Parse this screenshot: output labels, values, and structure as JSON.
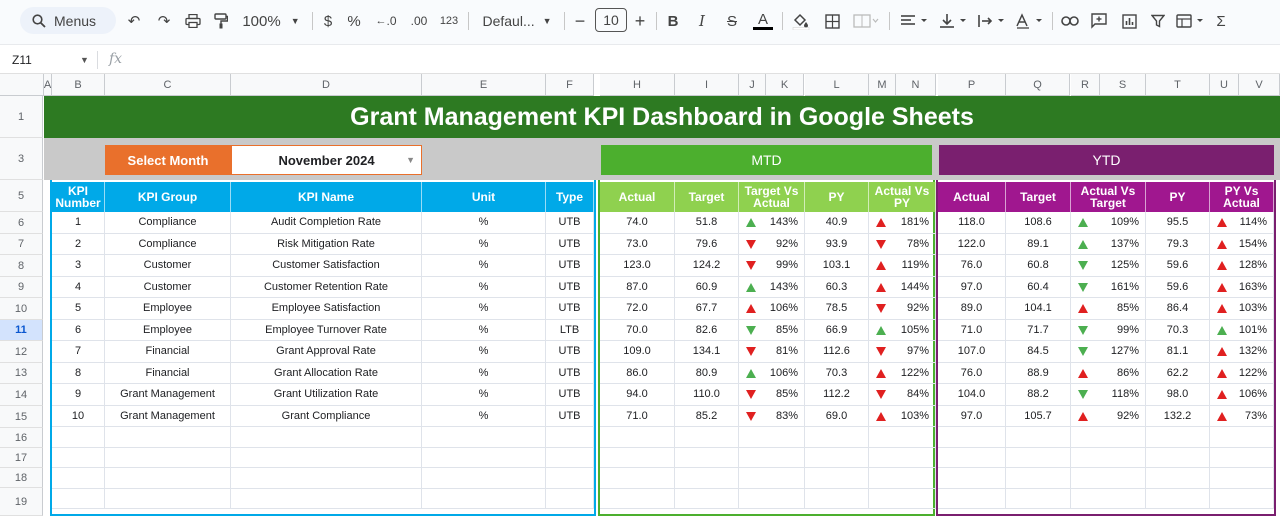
{
  "toolbar": {
    "search_label": "Menus",
    "zoom": "100%",
    "currency_symbol": "$",
    "percent_symbol": "%",
    "decimal_decrease": ".0",
    "decimal_increase": ".00",
    "number_format": "123",
    "font_name": "Defaul...",
    "font_size": "10",
    "bold": "B",
    "text_color": "A"
  },
  "formula_bar": {
    "cell_ref": "Z11",
    "fx": "fx"
  },
  "columns": [
    "A",
    "B",
    "C",
    "D",
    "E",
    "F",
    "H",
    "I",
    "J",
    "K",
    "L",
    "M",
    "N",
    "P",
    "Q",
    "R",
    "S",
    "T",
    "U",
    "V"
  ],
  "rows": [
    "1",
    "3",
    "5",
    "6",
    "7",
    "8",
    "9",
    "10",
    "11",
    "12",
    "13",
    "14",
    "15",
    "16",
    "17",
    "18",
    "19"
  ],
  "selected_row": "11",
  "dashboard": {
    "title": "Grant Management KPI Dashboard in Google Sheets",
    "select_month_label": "Select Month",
    "month_value": "November 2024",
    "mtd_label": "MTD",
    "ytd_label": "YTD"
  },
  "colors": {
    "title_bg": "#2d7a22",
    "select_month_bg": "#e9702c",
    "info_header": "#00a9e8",
    "mtd_band": "#4caf2e",
    "mtd_header": "#8fd14f",
    "ytd_band": "#7a1f6f",
    "ytd_header": "#a0178f",
    "arrow_red": "#e02020",
    "arrow_green": "#4caf50"
  },
  "info_headers": [
    "KPI Number",
    "KPI Group",
    "KPI Name",
    "Unit",
    "Type"
  ],
  "mtd_headers": [
    "Actual",
    "Target",
    "Target Vs Actual",
    "PY",
    "Actual Vs PY"
  ],
  "ytd_headers": [
    "Actual",
    "Target",
    "Actual Vs Target",
    "PY",
    "PY Vs Actual"
  ],
  "kpis": [
    {
      "num": "1",
      "group": "Compliance",
      "name": "Audit Completion Rate",
      "unit": "%",
      "type": "UTB",
      "mtd": {
        "actual": "74.0",
        "target": "51.8",
        "tva": "143%",
        "tva_icon": "up-green",
        "py": "40.9",
        "avp": "181%",
        "avp_icon": "up-red"
      },
      "ytd": {
        "actual": "118.0",
        "target": "108.6",
        "avt": "109%",
        "avt_icon": "up-green",
        "py": "95.5",
        "pva": "114%",
        "pva_icon": "up-red"
      }
    },
    {
      "num": "2",
      "group": "Compliance",
      "name": "Risk Mitigation Rate",
      "unit": "%",
      "type": "UTB",
      "mtd": {
        "actual": "73.0",
        "target": "79.6",
        "tva": "92%",
        "tva_icon": "down-red",
        "py": "93.9",
        "avp": "78%",
        "avp_icon": "down-red"
      },
      "ytd": {
        "actual": "122.0",
        "target": "89.1",
        "avt": "137%",
        "avt_icon": "up-green",
        "py": "79.3",
        "pva": "154%",
        "pva_icon": "up-red"
      }
    },
    {
      "num": "3",
      "group": "Customer",
      "name": "Customer Satisfaction",
      "unit": "%",
      "type": "UTB",
      "mtd": {
        "actual": "123.0",
        "target": "124.2",
        "tva": "99%",
        "tva_icon": "down-red",
        "py": "103.1",
        "avp": "119%",
        "avp_icon": "up-red"
      },
      "ytd": {
        "actual": "76.0",
        "target": "60.8",
        "avt": "125%",
        "avt_icon": "down-green",
        "py": "59.6",
        "pva": "128%",
        "pva_icon": "up-red"
      }
    },
    {
      "num": "4",
      "group": "Customer",
      "name": "Customer Retention Rate",
      "unit": "%",
      "type": "UTB",
      "mtd": {
        "actual": "87.0",
        "target": "60.9",
        "tva": "143%",
        "tva_icon": "up-green",
        "py": "60.3",
        "avp": "144%",
        "avp_icon": "up-red"
      },
      "ytd": {
        "actual": "97.0",
        "target": "60.4",
        "avt": "161%",
        "avt_icon": "down-green",
        "py": "59.6",
        "pva": "163%",
        "pva_icon": "up-red"
      }
    },
    {
      "num": "5",
      "group": "Employee",
      "name": "Employee Satisfaction",
      "unit": "%",
      "type": "UTB",
      "mtd": {
        "actual": "72.0",
        "target": "67.7",
        "tva": "106%",
        "tva_icon": "up-red",
        "py": "78.5",
        "avp": "92%",
        "avp_icon": "down-red"
      },
      "ytd": {
        "actual": "89.0",
        "target": "104.1",
        "avt": "85%",
        "avt_icon": "up-red",
        "py": "86.4",
        "pva": "103%",
        "pva_icon": "up-red"
      }
    },
    {
      "num": "6",
      "group": "Employee",
      "name": "Employee Turnover Rate",
      "unit": "%",
      "type": "LTB",
      "mtd": {
        "actual": "70.0",
        "target": "82.6",
        "tva": "85%",
        "tva_icon": "down-green",
        "py": "66.9",
        "avp": "105%",
        "avp_icon": "up-green"
      },
      "ytd": {
        "actual": "71.0",
        "target": "71.7",
        "avt": "99%",
        "avt_icon": "down-green",
        "py": "70.3",
        "pva": "101%",
        "pva_icon": "up-green"
      }
    },
    {
      "num": "7",
      "group": "Financial",
      "name": "Grant Approval Rate",
      "unit": "%",
      "type": "UTB",
      "mtd": {
        "actual": "109.0",
        "target": "134.1",
        "tva": "81%",
        "tva_icon": "down-red",
        "py": "112.6",
        "avp": "97%",
        "avp_icon": "down-red"
      },
      "ytd": {
        "actual": "107.0",
        "target": "84.5",
        "avt": "127%",
        "avt_icon": "down-green",
        "py": "81.1",
        "pva": "132%",
        "pva_icon": "up-red"
      }
    },
    {
      "num": "8",
      "group": "Financial",
      "name": "Grant Allocation Rate",
      "unit": "%",
      "type": "UTB",
      "mtd": {
        "actual": "86.0",
        "target": "80.9",
        "tva": "106%",
        "tva_icon": "up-green",
        "py": "70.3",
        "avp": "122%",
        "avp_icon": "up-red"
      },
      "ytd": {
        "actual": "76.0",
        "target": "88.9",
        "avt": "86%",
        "avt_icon": "up-red",
        "py": "62.2",
        "pva": "122%",
        "pva_icon": "up-red"
      }
    },
    {
      "num": "9",
      "group": "Grant Management",
      "name": "Grant Utilization Rate",
      "unit": "%",
      "type": "UTB",
      "mtd": {
        "actual": "94.0",
        "target": "110.0",
        "tva": "85%",
        "tva_icon": "down-red",
        "py": "112.2",
        "avp": "84%",
        "avp_icon": "down-red"
      },
      "ytd": {
        "actual": "104.0",
        "target": "88.2",
        "avt": "118%",
        "avt_icon": "down-green",
        "py": "98.0",
        "pva": "106%",
        "pva_icon": "up-red"
      }
    },
    {
      "num": "10",
      "group": "Grant Management",
      "name": "Grant Compliance",
      "unit": "%",
      "type": "UTB",
      "mtd": {
        "actual": "71.0",
        "target": "85.2",
        "tva": "83%",
        "tva_icon": "down-red",
        "py": "69.0",
        "avp": "103%",
        "avp_icon": "up-red"
      },
      "ytd": {
        "actual": "97.0",
        "target": "105.7",
        "avt": "92%",
        "avt_icon": "up-red",
        "py": "132.2",
        "pva": "73%",
        "pva_icon": "up-red"
      }
    }
  ]
}
